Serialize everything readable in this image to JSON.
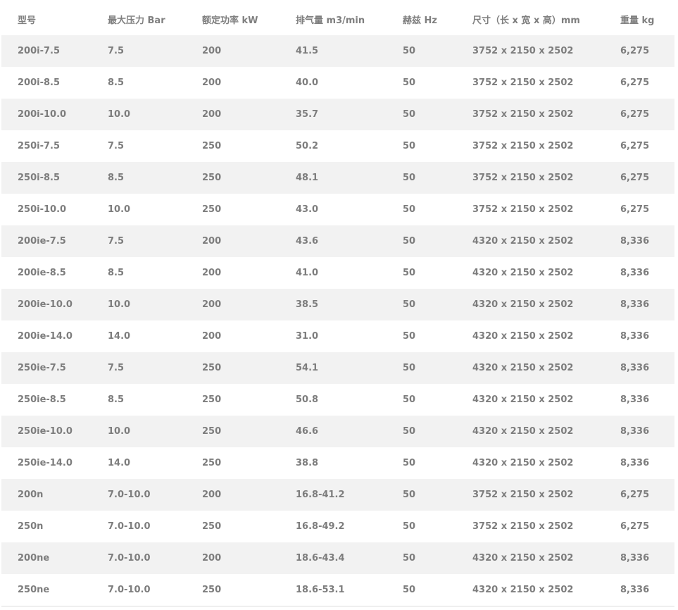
{
  "table": {
    "headers": [
      "型号",
      "最大压力 Bar",
      "额定功率 kW",
      "排气量 m3/min",
      "赫兹 Hz",
      "尺寸（长 x 宽 x 高）mm",
      "重量 kg"
    ],
    "rows": [
      [
        "200i-7.5",
        "7.5",
        "200",
        "41.5",
        "50",
        "3752 x 2150 x 2502",
        "6,275"
      ],
      [
        "200i-8.5",
        "8.5",
        "200",
        "40.0",
        "50",
        "3752 x 2150 x 2502",
        "6,275"
      ],
      [
        "200i-10.0",
        "10.0",
        "200",
        "35.7",
        "50",
        "3752 x 2150 x 2502",
        "6,275"
      ],
      [
        "250i-7.5",
        "7.5",
        "250",
        "50.2",
        "50",
        "3752 x 2150 x 2502",
        "6,275"
      ],
      [
        "250i-8.5",
        "8.5",
        "250",
        "48.1",
        "50",
        "3752 x 2150 x 2502",
        "6,275"
      ],
      [
        "250i-10.0",
        "10.0",
        "250",
        "43.0",
        "50",
        "3752 x 2150 x 2502",
        "6,275"
      ],
      [
        "200ie-7.5",
        "7.5",
        "200",
        "43.6",
        "50",
        "4320 x 2150 x 2502",
        "8,336"
      ],
      [
        "200ie-8.5",
        "8.5",
        "200",
        "41.0",
        "50",
        "4320 x 2150 x 2502",
        "8,336"
      ],
      [
        "200ie-10.0",
        "10.0",
        "200",
        "38.5",
        "50",
        "4320 x 2150 x 2502",
        "8,336"
      ],
      [
        "200ie-14.0",
        "14.0",
        "200",
        "31.0",
        "50",
        "4320 x 2150 x 2502",
        "8,336"
      ],
      [
        "250ie-7.5",
        "7.5",
        "250",
        "54.1",
        "50",
        "4320 x 2150 x 2502",
        "8,336"
      ],
      [
        "250ie-8.5",
        "8.5",
        "250",
        "50.8",
        "50",
        "4320 x 2150 x 2502",
        "8,336"
      ],
      [
        "250ie-10.0",
        "10.0",
        "250",
        "46.6",
        "50",
        "4320 x 2150 x 2502",
        "8,336"
      ],
      [
        "250ie-14.0",
        "14.0",
        "250",
        "38.8",
        "50",
        "4320 x 2150 x 2502",
        "8,336"
      ],
      [
        "200n",
        "7.0-10.0",
        "200",
        "16.8-41.2",
        "50",
        "3752 x 2150 x 2502",
        "6,275"
      ],
      [
        "250n",
        "7.0-10.0",
        "250",
        "16.8-49.2",
        "50",
        "3752 x 2150 x 2502",
        "6,275"
      ],
      [
        "200ne",
        "7.0-10.0",
        "200",
        "18.6-43.4",
        "50",
        "4320 x 2150 x 2502",
        "8,336"
      ],
      [
        "250ne",
        "7.0-10.0",
        "250",
        "18.6-53.1",
        "50",
        "4320 x 2150 x 2502",
        "8,336"
      ]
    ]
  }
}
